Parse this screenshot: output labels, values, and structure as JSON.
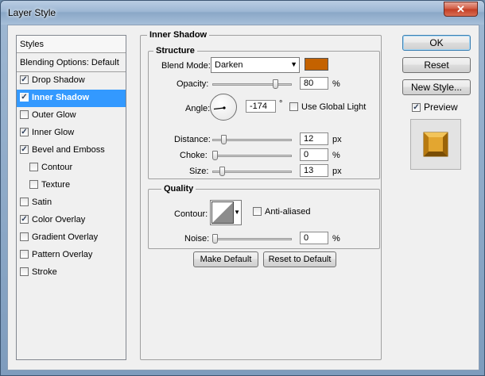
{
  "window": {
    "title": "Layer Style",
    "close_glyph": "✕"
  },
  "styles_panel": {
    "header": "Styles",
    "blending_options": "Blending Options: Default",
    "items": [
      {
        "label": "Drop Shadow",
        "checked": true,
        "selected": false,
        "sub": false
      },
      {
        "label": "Inner Shadow",
        "checked": true,
        "selected": true,
        "sub": false
      },
      {
        "label": "Outer Glow",
        "checked": false,
        "selected": false,
        "sub": false
      },
      {
        "label": "Inner Glow",
        "checked": true,
        "selected": false,
        "sub": false
      },
      {
        "label": "Bevel and Emboss",
        "checked": true,
        "selected": false,
        "sub": false
      },
      {
        "label": "Contour",
        "checked": false,
        "selected": false,
        "sub": true
      },
      {
        "label": "Texture",
        "checked": false,
        "selected": false,
        "sub": true
      },
      {
        "label": "Satin",
        "checked": false,
        "selected": false,
        "sub": false
      },
      {
        "label": "Color Overlay",
        "checked": true,
        "selected": false,
        "sub": false
      },
      {
        "label": "Gradient Overlay",
        "checked": false,
        "selected": false,
        "sub": false
      },
      {
        "label": "Pattern Overlay",
        "checked": false,
        "selected": false,
        "sub": false
      },
      {
        "label": "Stroke",
        "checked": false,
        "selected": false,
        "sub": false
      }
    ]
  },
  "inner_shadow": {
    "section_title": "Inner Shadow",
    "structure": {
      "title": "Structure",
      "blend_mode_label": "Blend Mode:",
      "blend_mode_value": "Darken",
      "shadow_color": "#c46200",
      "opacity_label": "Opacity:",
      "opacity_value": "80",
      "opacity_unit": "%",
      "angle_label": "Angle:",
      "angle_value": "-174",
      "angle_unit": "°",
      "use_global_light_label": "Use Global Light",
      "use_global_light": false,
      "distance_label": "Distance:",
      "distance_value": "12",
      "distance_unit": "px",
      "choke_label": "Choke:",
      "choke_value": "0",
      "choke_unit": "%",
      "size_label": "Size:",
      "size_value": "13",
      "size_unit": "px"
    },
    "quality": {
      "title": "Quality",
      "contour_label": "Contour:",
      "anti_aliased_label": "Anti-aliased",
      "anti_aliased": false,
      "noise_label": "Noise:",
      "noise_value": "0",
      "noise_unit": "%"
    },
    "make_default_label": "Make Default",
    "reset_to_default_label": "Reset to Default"
  },
  "actions": {
    "ok_label": "OK",
    "reset_label": "Reset",
    "new_style_label": "New Style...",
    "preview_label": "Preview",
    "preview_checked": true,
    "preview_color": "#d89a1f"
  }
}
